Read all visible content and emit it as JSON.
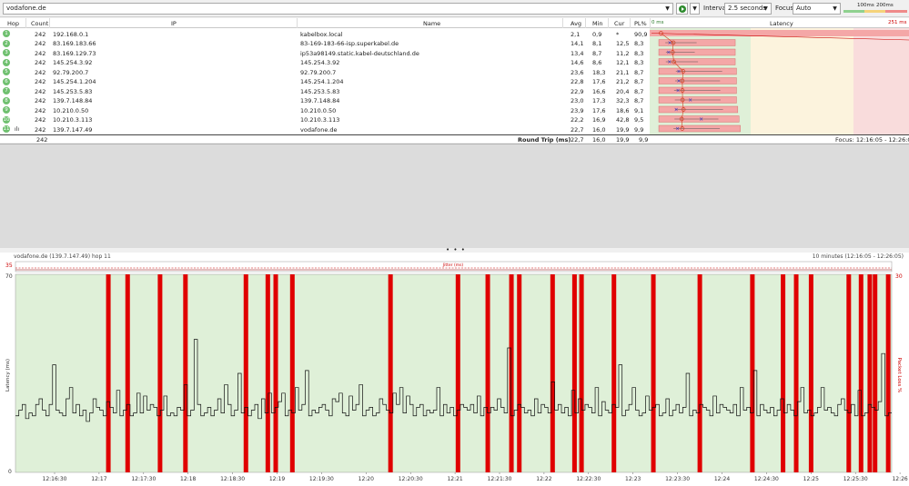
{
  "toolbar": {
    "target": "vodafone.de",
    "interval_label": "Interval",
    "interval_value": "2.5 seconds",
    "focus_label": "Focus",
    "focus_value": "Auto",
    "legend": [
      "100ms",
      "200ms"
    ]
  },
  "table": {
    "headers": {
      "hop": "Hop",
      "count": "Count",
      "ip": "IP",
      "name": "Name",
      "avg": "Avg",
      "min": "Min",
      "cur": "Cur",
      "pl": "PL%",
      "latency": "Latency"
    },
    "latency_scale": {
      "min_label": "0 ms",
      "max_label": "251 ms"
    },
    "rows": [
      {
        "hop": "1",
        "count": "242",
        "ip": "192.168.0.1",
        "name": "kabelbox.local",
        "avg": "2,1",
        "min": "0,9",
        "cur": "*",
        "pl": "90,9"
      },
      {
        "hop": "2",
        "count": "242",
        "ip": "83.169.183.66",
        "name": "83-169-183-66-isp.superkabel.de",
        "avg": "14,1",
        "min": "8,1",
        "cur": "12,5",
        "pl": "8,3"
      },
      {
        "hop": "3",
        "count": "242",
        "ip": "83.169.129.73",
        "name": "ip53a98149.static.kabel-deutschland.de",
        "avg": "13,4",
        "min": "8,7",
        "cur": "11,2",
        "pl": "8,3"
      },
      {
        "hop": "4",
        "count": "242",
        "ip": "145.254.3.92",
        "name": "145.254.3.92",
        "avg": "14,6",
        "min": "8,6",
        "cur": "12,1",
        "pl": "8,3"
      },
      {
        "hop": "5",
        "count": "242",
        "ip": "92.79.200.7",
        "name": "92.79.200.7",
        "avg": "23,6",
        "min": "18,3",
        "cur": "21,1",
        "pl": "8,7"
      },
      {
        "hop": "6",
        "count": "242",
        "ip": "145.254.1.204",
        "name": "145.254.1.204",
        "avg": "22,8",
        "min": "17,6",
        "cur": "21,2",
        "pl": "8,7"
      },
      {
        "hop": "7",
        "count": "242",
        "ip": "145.253.5.83",
        "name": "145.253.5.83",
        "avg": "22,9",
        "min": "16,6",
        "cur": "20,4",
        "pl": "8,7"
      },
      {
        "hop": "8",
        "count": "242",
        "ip": "139.7.148.84",
        "name": "139.7.148.84",
        "avg": "23,0",
        "min": "17,3",
        "cur": "32,3",
        "pl": "8,7"
      },
      {
        "hop": "9",
        "count": "242",
        "ip": "10.210.0.50",
        "name": "10.210.0.50",
        "avg": "23,9",
        "min": "17,6",
        "cur": "18,6",
        "pl": "9,1"
      },
      {
        "hop": "10",
        "count": "242",
        "ip": "10.210.3.113",
        "name": "10.210.3.113",
        "avg": "22,2",
        "min": "16,9",
        "cur": "42,8",
        "pl": "9,5"
      },
      {
        "hop": "11",
        "count": "242",
        "ip": "139.7.147.49",
        "name": "vodafone.de",
        "avg": "22,7",
        "min": "16,0",
        "cur": "19,9",
        "pl": "9,9"
      }
    ],
    "footer": {
      "count": "242",
      "label": "Round Trip (ms)",
      "avg": "22,7",
      "min": "16,0",
      "cur": "19,9",
      "pl": "9,9",
      "focus": "Focus: 12:16:05 - 12:26:05"
    }
  },
  "graph": {
    "title": "vodafone.de (139.7.147.49) hop 11",
    "range": "10 minutes (12:16:05 - 12:26:05)",
    "jitter_label": "Jitter (ms)",
    "jitter_max": "35",
    "y_left_label": "Latency (ms)",
    "y_right_label": "Packet Loss %",
    "y_left_max": "70",
    "y_left_min": "0",
    "y_right_max": "30",
    "x_ticks": [
      "12:16:30",
      "12:17",
      "12:17:30",
      "12:18",
      "12:18:30",
      "12:19",
      "12:19:30",
      "12:20",
      "12:20:30",
      "12:21",
      "12:21:30",
      "12:22",
      "12:22:30",
      "12:23",
      "12:23:30",
      "12:24",
      "12:24:30",
      "12:25",
      "12:25:30",
      "12:26"
    ]
  },
  "chart_data": {
    "type": "line",
    "title": "vodafone.de (139.7.147.49) hop 11",
    "xlabel": "",
    "ylabel": "Latency (ms)",
    "ylim": [
      0,
      70
    ],
    "y2label": "Packet Loss %",
    "y2lim": [
      0,
      30
    ],
    "x_range": [
      "12:16:05",
      "12:26:05"
    ],
    "latency_series": [
      20,
      22,
      24,
      19,
      21,
      20,
      24,
      26,
      22,
      20,
      24,
      38,
      22,
      21,
      20,
      26,
      30,
      21,
      24,
      20,
      22,
      18,
      21,
      26,
      23,
      22,
      20,
      25,
      23,
      21,
      29,
      20,
      22,
      24,
      20,
      21,
      28,
      21,
      27,
      22,
      24,
      23,
      20,
      22,
      27,
      20,
      21,
      20,
      23,
      22,
      31,
      20,
      22,
      47,
      24,
      20,
      21,
      23,
      20,
      22,
      26,
      21,
      31,
      24,
      20,
      22,
      35,
      21,
      23,
      20,
      22,
      24,
      19,
      26,
      21,
      28,
      21,
      23,
      25,
      28,
      20,
      22,
      21,
      30,
      22,
      24,
      36,
      20,
      22,
      21,
      23,
      24,
      22,
      20,
      26,
      25,
      28,
      21,
      20,
      27,
      22,
      24,
      31,
      20,
      22,
      23,
      20,
      21,
      26,
      24,
      22,
      21,
      28,
      24,
      30,
      21,
      27,
      24,
      20,
      23,
      24,
      20,
      22,
      21,
      22,
      30,
      20,
      24,
      21,
      23,
      20,
      22,
      24,
      23,
      22,
      24,
      21,
      27,
      20,
      23,
      21,
      23,
      22,
      26,
      23,
      21,
      44,
      20,
      22,
      24,
      23,
      21,
      22,
      20,
      26,
      21,
      24,
      23,
      21,
      32,
      22,
      24,
      21,
      23,
      20,
      29,
      21,
      26,
      22,
      24,
      23,
      21,
      30,
      20,
      25,
      22,
      21,
      24,
      23,
      38,
      20,
      22,
      24,
      30,
      22,
      20,
      21,
      27,
      22,
      23,
      24,
      20,
      21,
      26,
      20,
      22,
      24,
      21,
      23,
      35,
      20,
      22,
      21,
      24,
      23,
      22,
      20,
      27,
      21,
      24,
      23,
      22,
      21,
      24,
      20,
      30,
      22,
      23,
      21,
      36,
      20,
      24,
      22,
      21,
      23,
      20,
      22,
      26,
      21,
      24,
      22,
      20,
      25,
      30,
      21,
      22,
      20,
      21,
      23,
      30,
      22,
      23,
      21,
      20,
      24,
      26,
      22,
      21,
      24,
      20,
      29,
      20,
      21,
      24,
      23,
      22,
      25,
      42,
      20,
      21
    ],
    "loss_columns_x_fraction": [
      0.106,
      0.128,
      0.165,
      0.194,
      0.263,
      0.288,
      0.297,
      0.316,
      0.428,
      0.505,
      0.539,
      0.566,
      0.575,
      0.613,
      0.638,
      0.646,
      0.683,
      0.728,
      0.781,
      0.841,
      0.876,
      0.891,
      0.908,
      0.951,
      0.965,
      0.975,
      0.981,
      0.996
    ],
    "latency_bars": [
      {
        "hop": "1",
        "avg": 2.1,
        "min": 0.9,
        "cur": null,
        "pl": 90.9
      },
      {
        "hop": "2",
        "avg": 14.1,
        "min": 8.1,
        "cur": 12.5,
        "pl": 8.3
      },
      {
        "hop": "3",
        "avg": 13.4,
        "min": 8.7,
        "cur": 11.2,
        "pl": 8.3
      },
      {
        "hop": "4",
        "avg": 14.6,
        "min": 8.6,
        "cur": 12.1,
        "pl": 8.3
      },
      {
        "hop": "5",
        "avg": 23.6,
        "min": 18.3,
        "cur": 21.1,
        "pl": 8.7
      },
      {
        "hop": "6",
        "avg": 22.8,
        "min": 17.6,
        "cur": 21.2,
        "pl": 8.7
      },
      {
        "hop": "7",
        "avg": 22.9,
        "min": 16.6,
        "cur": 20.4,
        "pl": 8.7
      },
      {
        "hop": "8",
        "avg": 23.0,
        "min": 17.3,
        "cur": 32.3,
        "pl": 8.7
      },
      {
        "hop": "9",
        "avg": 23.9,
        "min": 17.6,
        "cur": 18.6,
        "pl": 9.1
      },
      {
        "hop": "10",
        "avg": 22.2,
        "min": 16.9,
        "cur": 42.8,
        "pl": 9.5
      },
      {
        "hop": "11",
        "avg": 22.7,
        "min": 16.0,
        "cur": 19.9,
        "pl": 9.9
      }
    ]
  },
  "colors": {
    "good": "#dff0d8",
    "warn": "#fbeed5",
    "bad": "#f8d7da",
    "loss": "#e00000",
    "hop_badge": "#6fc06f",
    "latency_bar": "#f4a7a7"
  },
  "icons": {
    "play": "play-icon",
    "dropdown": "chevron-down-icon",
    "graph_row": "bar-chart-icon"
  }
}
